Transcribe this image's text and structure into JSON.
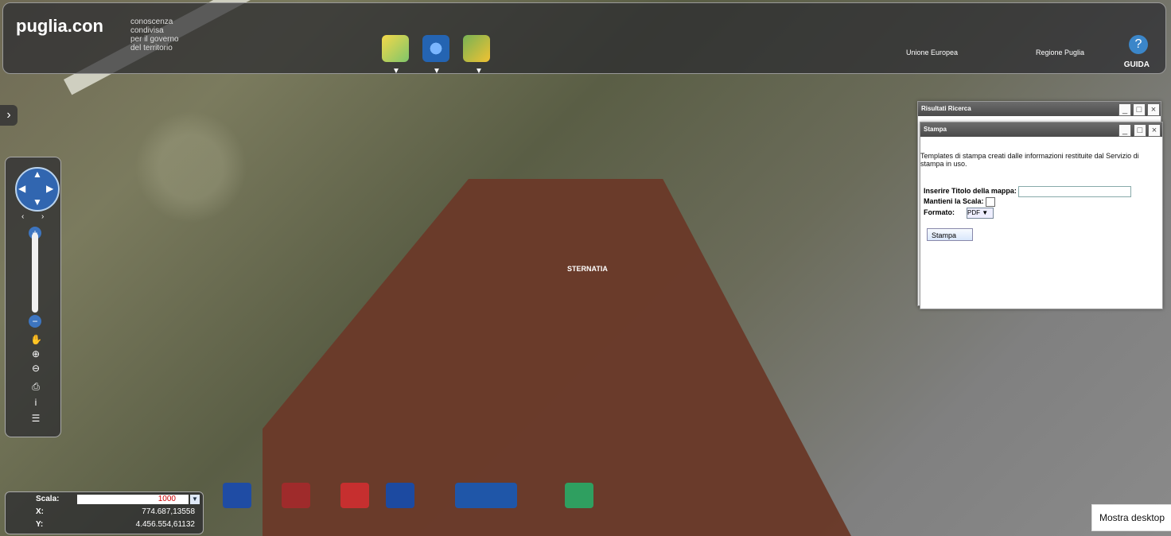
{
  "header": {
    "brand": "puglia.con",
    "tagline": "conoscenza\ncondivisa\nper il governo\ndel territorio",
    "logos": [
      "Unione Europea",
      "Regione Puglia"
    ],
    "guide_label": "GUIDA"
  },
  "map": {
    "place_label": "STERNATIA"
  },
  "left_panel": {
    "scale_label": "Scala:",
    "scale_value": "1000",
    "x_label": "X:",
    "x_value": "774.687,13558",
    "y_label": "Y:",
    "y_value": "4.456.554,61132"
  },
  "results_window": {
    "title": "Risultati Ricerca"
  },
  "print_window": {
    "title": "Stampa",
    "description": "Templates di stampa creati dalle informazioni restituite dal Servizio di stampa in uso.",
    "title_label": "Inserire Titolo della mappa:",
    "keep_scale_label": "Mantieni la Scala:",
    "format_label": "Formato:",
    "format_value": "PDF",
    "print_button": "Stampa"
  },
  "bottom": {
    "show_desktop": "Mostra desktop"
  },
  "colors": {
    "accent": "#3b86c9"
  }
}
